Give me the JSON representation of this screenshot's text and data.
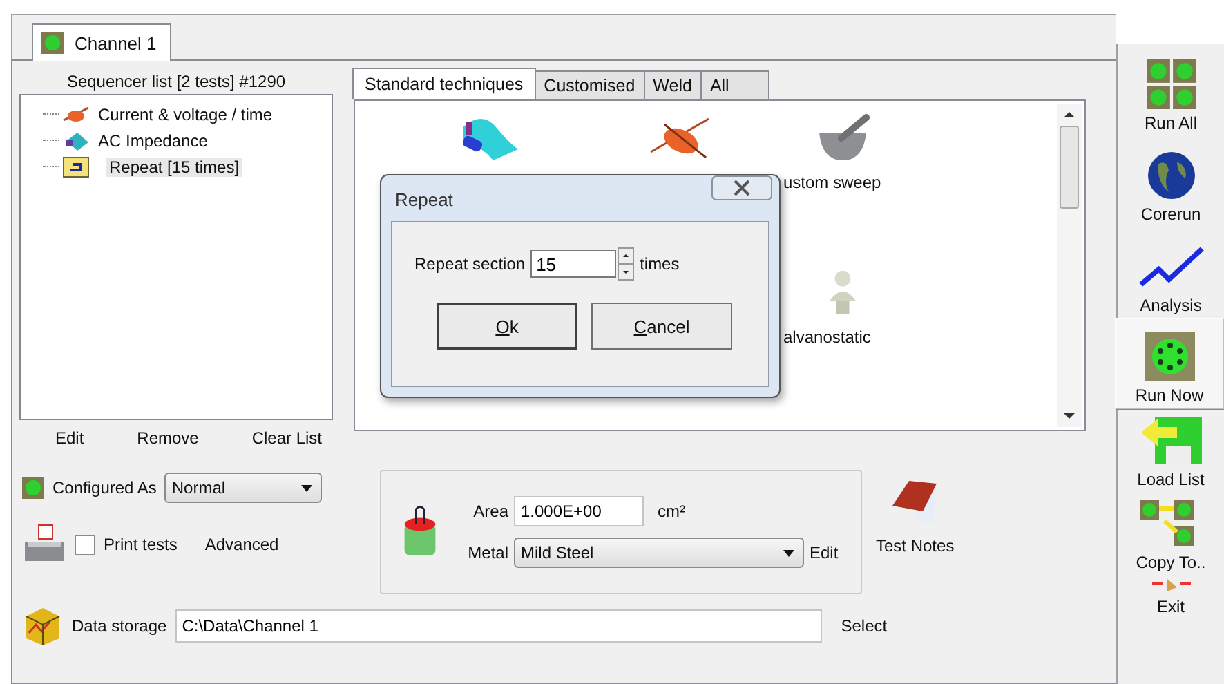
{
  "channel_tab": {
    "label": "Channel 1",
    "selected": true
  },
  "sequencer": {
    "title": "Sequencer list [2 tests] #1290",
    "items": [
      {
        "label": "Current & voltage / time",
        "kind": "scan",
        "selected": false
      },
      {
        "label": "AC Impedance",
        "kind": "impedance",
        "selected": false
      },
      {
        "label": "Repeat [15 times]",
        "kind": "repeat",
        "selected": true
      }
    ],
    "buttons": [
      "Edit",
      "Remove",
      "Clear List"
    ]
  },
  "technique_tabs": [
    {
      "label": "Standard techniques",
      "selected": true
    },
    {
      "label": "Customised",
      "selected": false
    },
    {
      "label": "Weld",
      "selected": false
    },
    {
      "label": "All",
      "selected": false
    }
  ],
  "techniques": [
    {
      "kind": "surface"
    },
    {
      "kind": "violin"
    },
    {
      "kind": "mortar",
      "label": "ustom sweep"
    },
    {
      "kind": "blank"
    },
    {
      "kind": "blank"
    },
    {
      "kind": "bust",
      "label": "alvanostatic"
    }
  ],
  "dialog": {
    "title": "Repeat",
    "label": "Repeat section",
    "value": "15",
    "unit": "times",
    "buttons": [
      {
        "mnemonic": "O",
        "rest": "k",
        "default": true
      },
      {
        "mnemonic": "C",
        "rest": "ancel",
        "default": false
      }
    ]
  },
  "configured_as": {
    "label": "Configured As",
    "value": "Normal"
  },
  "print_tests": {
    "label": "Print tests",
    "checked": false
  },
  "advanced": "Advanced",
  "area": {
    "label": "Area",
    "value": "1.000E+00",
    "unit": "cm²"
  },
  "metal": {
    "label": "Metal",
    "value": "Mild Steel"
  },
  "metal_edit": "Edit",
  "test_notes": "Test Notes",
  "data_storage": {
    "label": "Data storage",
    "value": "C:\\Data\\Channel 1"
  },
  "select": "Select",
  "sidebar": [
    {
      "label": "Run All",
      "kind": "run_all",
      "selected": false
    },
    {
      "label": "Corerun",
      "kind": "globe",
      "selected": false
    },
    {
      "label": "Analysis",
      "kind": "chart",
      "selected": false
    },
    {
      "label": "Run Now",
      "kind": "run_now",
      "selected": true
    },
    {
      "label": "Load List",
      "kind": "load",
      "selected": false
    },
    {
      "label": "Copy To..",
      "kind": "copy",
      "selected": false
    },
    {
      "label": "Exit",
      "kind": "exit",
      "selected": false
    }
  ]
}
